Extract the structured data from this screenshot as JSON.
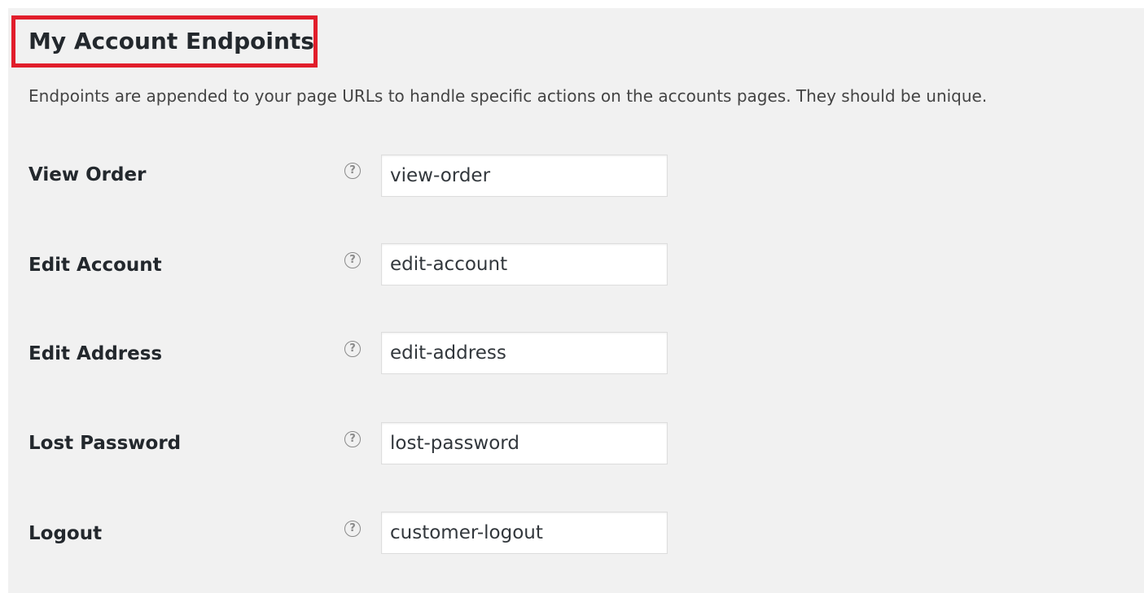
{
  "section": {
    "title": "My Account Endpoints",
    "description": "Endpoints are appended to your page URLs to handle specific actions on the accounts pages. They should be unique.",
    "help_glyph": "?"
  },
  "fields": [
    {
      "label": "View Order",
      "value": "view-order"
    },
    {
      "label": "Edit Account",
      "value": "edit-account"
    },
    {
      "label": "Edit Address",
      "value": "edit-address"
    },
    {
      "label": "Lost Password",
      "value": "lost-password"
    },
    {
      "label": "Logout",
      "value": "customer-logout"
    }
  ],
  "colors": {
    "highlight_border": "#e11d2b",
    "panel_background": "#f1f1f1"
  }
}
